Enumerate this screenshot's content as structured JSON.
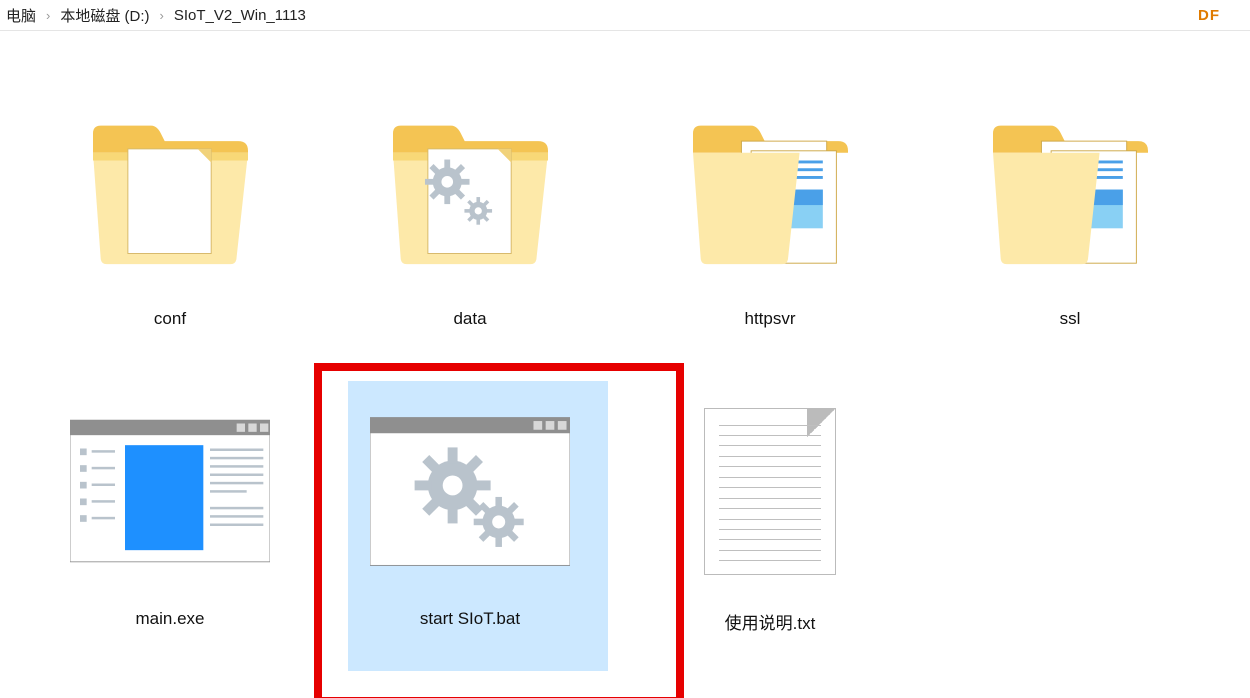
{
  "breadcrumb": {
    "c0": "电脑",
    "c1": "本地磁盘 (D:)",
    "c2": "SIoT_V2_Win_1113",
    "sep": "›",
    "df": "DF"
  },
  "items": {
    "conf": {
      "label": "conf"
    },
    "data": {
      "label": "data"
    },
    "httpsvr": {
      "label": "httpsvr"
    },
    "ssl": {
      "label": "ssl"
    },
    "main": {
      "label": "main.exe"
    },
    "start": {
      "label": "start SIoT.bat"
    },
    "readme": {
      "label": "使用说明.txt"
    }
  }
}
